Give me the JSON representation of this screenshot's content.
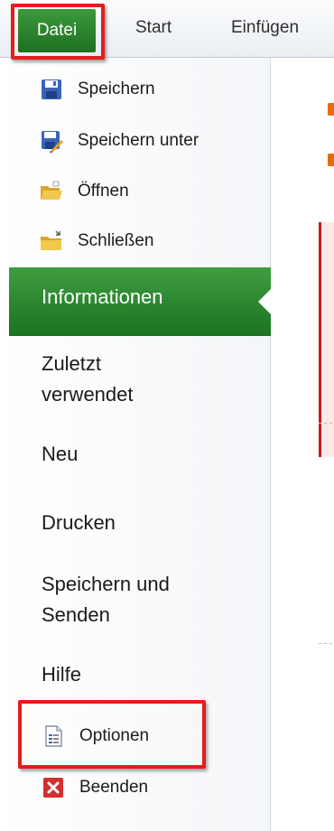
{
  "ribbon": {
    "tabs": {
      "datei": "Datei",
      "start": "Start",
      "einfuegen": "Einfügen"
    }
  },
  "backstage": {
    "commands": {
      "speichern": {
        "label": "Speichern",
        "icon": "save-icon"
      },
      "speichern_unter": {
        "label": "Speichern unter",
        "icon": "save-as-icon"
      },
      "oeffnen": {
        "label": "Öffnen",
        "icon": "open-folder-icon"
      },
      "schliessen": {
        "label": "Schließen",
        "icon": "close-folder-icon"
      }
    },
    "nav": {
      "informationen": "Informationen",
      "zuletzt_line1": "Zuletzt",
      "zuletzt_line2": "verwendet",
      "neu": "Neu",
      "drucken": "Drucken",
      "senden_line1": "Speichern und",
      "senden_line2": "Senden",
      "hilfe": "Hilfe"
    },
    "bottom": {
      "optionen": {
        "label": "Optionen",
        "icon": "options-icon"
      },
      "beenden": {
        "label": "Beenden",
        "icon": "exit-icon"
      }
    }
  },
  "colors": {
    "accent_green": "#2a8a2e",
    "highlight_red": "#e41d1d"
  }
}
